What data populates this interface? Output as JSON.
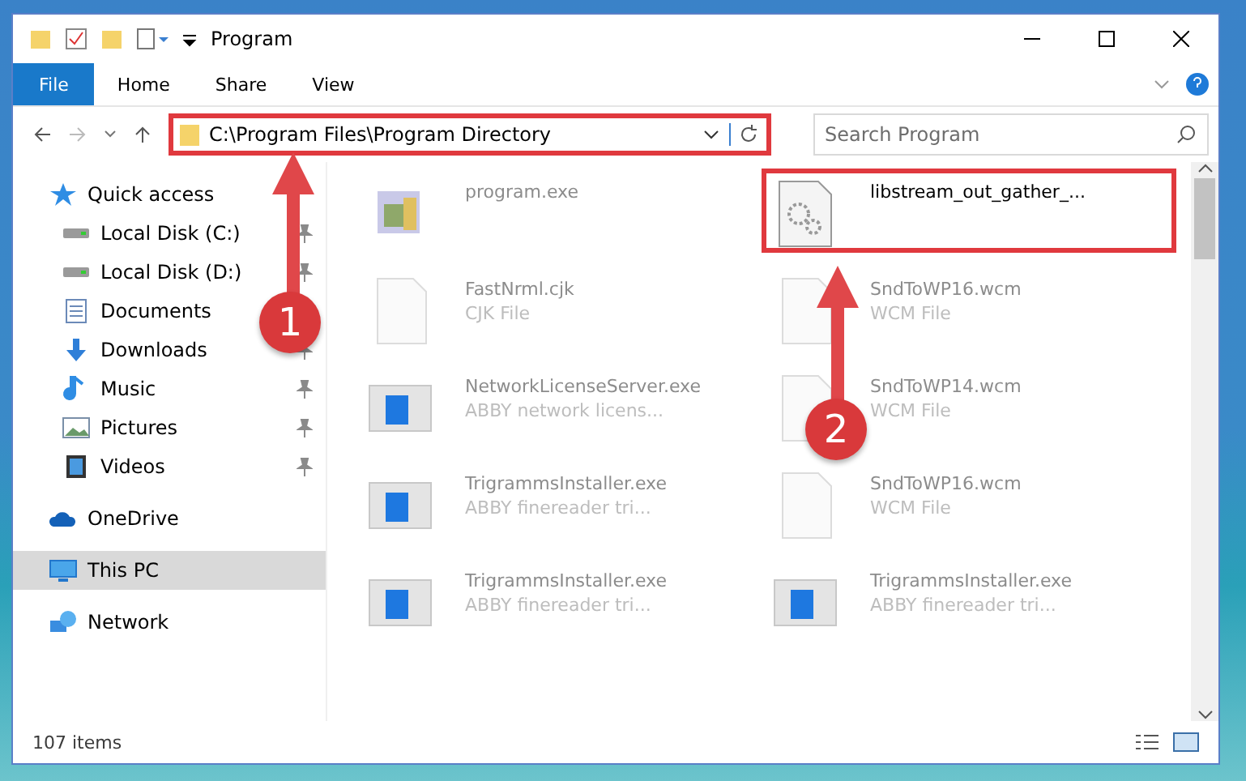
{
  "window": {
    "title": "Program"
  },
  "ribbon": {
    "tabs": [
      {
        "label": "File",
        "kind": "file"
      },
      {
        "label": "Home",
        "kind": "tab"
      },
      {
        "label": "Share",
        "kind": "tab"
      },
      {
        "label": "View",
        "kind": "tab"
      }
    ]
  },
  "address": {
    "path": "C:\\Program Files\\Program Directory",
    "highlighted": true
  },
  "search": {
    "placeholder": "Search Program"
  },
  "sidebar": {
    "items": [
      {
        "label": "Quick access",
        "kind": "star",
        "selected": false,
        "children": [
          {
            "label": "Local Disk (C:)",
            "kind": "drive",
            "pinned": true,
            "selected": false
          },
          {
            "label": "Local Disk (D:)",
            "kind": "drive",
            "pinned": true,
            "selected": false
          },
          {
            "label": "Documents",
            "kind": "document",
            "selected": false
          },
          {
            "label": "Downloads",
            "kind": "download",
            "pinned": true,
            "selected": false
          },
          {
            "label": "Music",
            "kind": "music",
            "pinned": true,
            "selected": false
          },
          {
            "label": "Pictures",
            "kind": "pictures",
            "pinned": true,
            "selected": false
          },
          {
            "label": "Videos",
            "kind": "videos",
            "pinned": true,
            "selected": false
          }
        ]
      },
      {
        "label": "OneDrive",
        "kind": "cloud",
        "selected": false
      },
      {
        "label": "This PC",
        "kind": "pc",
        "selected": true
      },
      {
        "label": "Network",
        "kind": "network",
        "selected": false
      }
    ]
  },
  "files": [
    {
      "name": "program.exe",
      "kind": "exe",
      "highlighted": false
    },
    {
      "name": "libstream_out_gather_...",
      "kind": "gears",
      "highlighted": true
    },
    {
      "name": "FastNrml.cjk",
      "type": "CJK File",
      "kind": "blank",
      "highlighted": false
    },
    {
      "name": "SndToWP16.wcm",
      "type": "WCM File",
      "kind": "blank",
      "highlighted": false
    },
    {
      "name": "NetworkLicenseServer.exe",
      "type": "ABBY network licens...",
      "kind": "app",
      "highlighted": false
    },
    {
      "name": "SndToWP14.wcm",
      "type": "WCM File",
      "kind": "blank",
      "highlighted": false
    },
    {
      "name": "TrigrammsInstaller.exe",
      "type": "ABBY finereader tri...",
      "kind": "app",
      "highlighted": false
    },
    {
      "name": "SndToWP16.wcm",
      "type": "WCM File",
      "kind": "blank",
      "highlighted": false
    },
    {
      "name": "TrigrammsInstaller.exe",
      "type": "ABBY finereader tri...",
      "kind": "app",
      "highlighted": false
    },
    {
      "name": "TrigrammsInstaller.exe",
      "type": "ABBY finereader tri...",
      "kind": "app",
      "highlighted": false
    }
  ],
  "status_bar": {
    "count": "107 items"
  },
  "annotations": [
    {
      "label": "1"
    },
    {
      "label": "2"
    }
  ]
}
